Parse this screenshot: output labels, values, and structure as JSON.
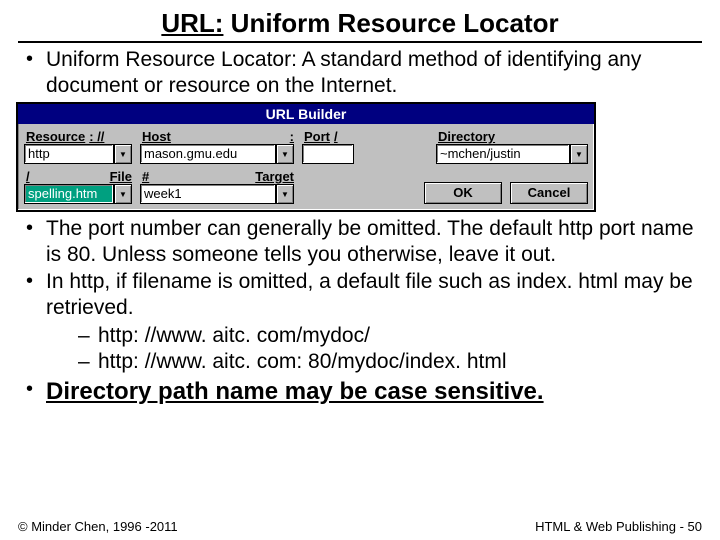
{
  "title": {
    "prefix": "URL:",
    "rest": " Uniform Resource Locator"
  },
  "bullets": {
    "definition": "Uniform Resource Locator: A standard method of identifying any document or resource on the Internet.",
    "port": "The port number can generally be omitted.  The default http port name is 80.  Unless someone tells you otherwise, leave it out.",
    "filename": "In http, if filename is omitted, a default file such as index. html may be retrieved.",
    "ex1": "http: //www. aitc. com/mydoc/",
    "ex2": "http: //www. aitc. com: 80/mydoc/index. html",
    "case": "Directory path name may be case sensitive."
  },
  "builder": {
    "title": "URL Builder",
    "labels": {
      "resource": "Resource",
      "sep_scheme": ": //",
      "host": "Host",
      "sep_port": ":",
      "port": "Port",
      "sep_slash": "/",
      "directory": "Directory",
      "slash": "/",
      "file": "File",
      "hash": "#",
      "target": "Target"
    },
    "values": {
      "resource": "http",
      "host": "mason.gmu.edu",
      "port": "",
      "directory": "~mchen/justin",
      "file": "spelling.htm",
      "target": "week1"
    },
    "buttons": {
      "ok": "OK",
      "cancel": "Cancel"
    }
  },
  "footer": {
    "left": "© Minder Chen, 1996 -2011",
    "right": "HTML & Web Publishing - 50"
  }
}
